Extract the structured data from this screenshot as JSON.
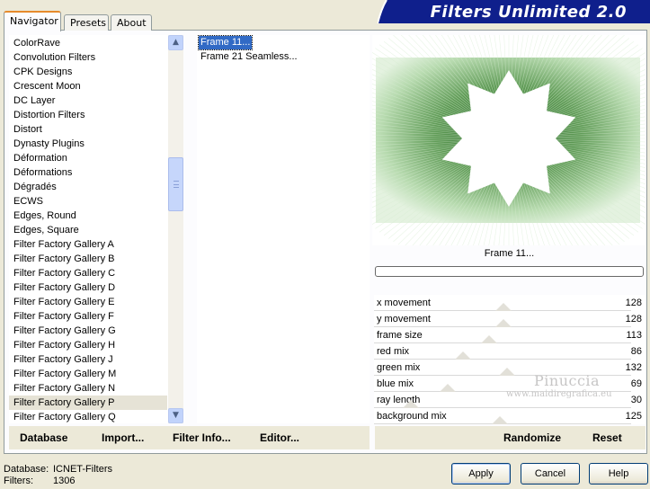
{
  "banner": {
    "title": "Filters Unlimited 2.0"
  },
  "tabs": [
    {
      "label": "Navigator"
    },
    {
      "label": "Presets"
    },
    {
      "label": "About"
    }
  ],
  "categories": [
    "ColorRave",
    "Convolution Filters",
    "CPK Designs",
    "Crescent Moon",
    "DC Layer",
    "Distortion Filters",
    "Distort",
    "Dynasty Plugins",
    "Déformation",
    "Déformations",
    "Dégradés",
    "ECWS",
    "Edges, Round",
    "Edges, Square",
    "Filter Factory Gallery A",
    "Filter Factory Gallery B",
    "Filter Factory Gallery C",
    "Filter Factory Gallery D",
    "Filter Factory Gallery E",
    "Filter Factory Gallery F",
    "Filter Factory Gallery G",
    "Filter Factory Gallery H",
    "Filter Factory Gallery J",
    "Filter Factory Gallery M",
    "Filter Factory Gallery N",
    "Filter Factory Gallery P",
    "Filter Factory Gallery Q"
  ],
  "selected_category": "Filter Factory Gallery P",
  "filters": [
    "Frame 11...",
    "Frame 21 Seamless..."
  ],
  "selected_filter": "Frame 11...",
  "preview": {
    "filter_name": "Frame 11..."
  },
  "sliders": [
    {
      "label": "x movement",
      "value": 128
    },
    {
      "label": "y movement",
      "value": 128
    },
    {
      "label": "frame size",
      "value": 113
    },
    {
      "label": "red mix",
      "value": 86
    },
    {
      "label": "green mix",
      "value": 132
    },
    {
      "label": "blue mix",
      "value": 69
    },
    {
      "label": "ray length",
      "value": 30
    },
    {
      "label": "background mix",
      "value": 125
    }
  ],
  "watermark": {
    "name": "Pinuccia",
    "url": "www.maidiregrafica.eu"
  },
  "toolbar": {
    "database": "Database",
    "import": "Import...",
    "filter_info": "Filter Info...",
    "editor": "Editor...",
    "randomize": "Randomize",
    "reset": "Reset"
  },
  "footer": {
    "database_label": "Database:",
    "database_value": "ICNET-Filters",
    "filters_label": "Filters:",
    "filters_value": "1306",
    "apply": "Apply",
    "cancel": "Cancel",
    "help": "Help"
  },
  "colors": {
    "banner": "#0f1f8c",
    "selection": "#316ac5",
    "tab_highlight": "#e68b2c"
  }
}
